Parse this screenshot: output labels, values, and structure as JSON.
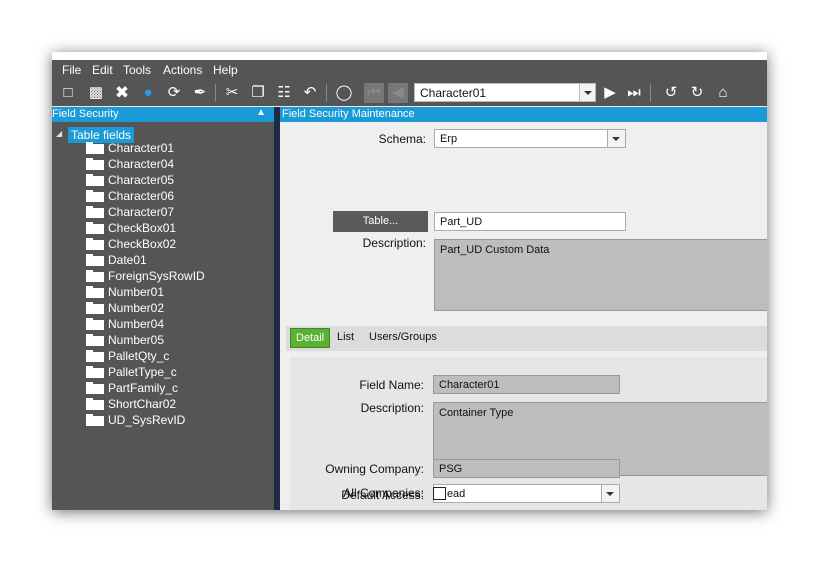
{
  "menu": [
    "File",
    "Edit",
    "Tools",
    "Actions",
    "Help"
  ],
  "toolbar": {
    "icons": [
      "new-icon",
      "save-icon",
      "delete-icon",
      "chat-icon",
      "refresh-icon",
      "clear-icon",
      "cut-icon",
      "copy-icon",
      "paste-icon",
      "undo-icon",
      "binoculars-icon",
      "first-record-icon",
      "previous-record-icon",
      "next-record-icon",
      "last-record-icon",
      "back-icon",
      "forward-icon",
      "home-icon"
    ],
    "record_combo_value": "Character01"
  },
  "left_panel": {
    "title": "Field Security",
    "root_label": "Table fields",
    "items": [
      "Character01",
      "Character04",
      "Character05",
      "Character06",
      "Character07",
      "CheckBox01",
      "CheckBox02",
      "Date01",
      "ForeignSysRowID",
      "Number01",
      "Number02",
      "Number04",
      "Number05",
      "PalletQty_c",
      "PalletType_c",
      "PartFamily_c",
      "ShortChar02",
      "UD_SysRevID"
    ]
  },
  "right_panel": {
    "title": "Field Security Maintenance",
    "schema_label": "Schema:",
    "schema_value": "Erp",
    "table_button": "Table...",
    "table_value": "Part_UD",
    "description_label": "Description:",
    "description_value": "Part_UD Custom Data",
    "tabs": [
      "Detail",
      "List",
      "Users/Groups"
    ],
    "detail": {
      "field_name_label": "Field Name:",
      "field_name_value": "Character01",
      "description_label": "Description:",
      "description_value": "Container Type",
      "default_access_label": "Default Access:",
      "default_access_value": "Read",
      "owning_company_label": "Owning Company:",
      "owning_company_value": "PSG",
      "all_companies_label": "All Companies:",
      "all_companies_checked": false
    }
  },
  "colors": {
    "header_blue": "#1a9ad6",
    "dark_gray": "#555555",
    "active_tab_green": "#5cb034"
  }
}
